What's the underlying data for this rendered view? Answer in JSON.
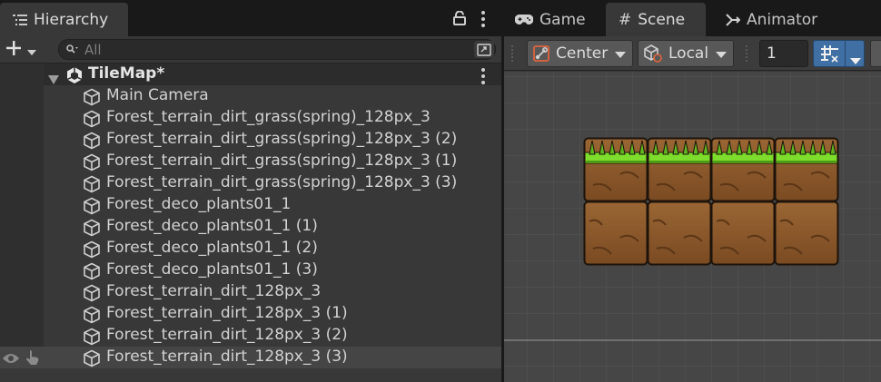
{
  "hierarchy": {
    "tab_label": "Hierarchy",
    "search_placeholder": "All",
    "scene_name": "TileMap*",
    "items": [
      {
        "label": "Main Camera"
      },
      {
        "label": "Forest_terrain_dirt_grass(spring)_128px_3"
      },
      {
        "label": "Forest_terrain_dirt_grass(spring)_128px_3 (2)"
      },
      {
        "label": "Forest_terrain_dirt_grass(spring)_128px_3 (1)"
      },
      {
        "label": "Forest_terrain_dirt_grass(spring)_128px_3 (3)"
      },
      {
        "label": "Forest_deco_plants01_1"
      },
      {
        "label": "Forest_deco_plants01_1 (1)"
      },
      {
        "label": "Forest_deco_plants01_1 (2)"
      },
      {
        "label": "Forest_deco_plants01_1 (3)"
      },
      {
        "label": "Forest_terrain_dirt_128px_3"
      },
      {
        "label": "Forest_terrain_dirt_128px_3 (1)"
      },
      {
        "label": "Forest_terrain_dirt_128px_3 (2)"
      },
      {
        "label": "Forest_terrain_dirt_128px_3 (3)"
      }
    ]
  },
  "tabs": {
    "game": "Game",
    "scene": "Scene",
    "animator": "Animator"
  },
  "scene_toolbar": {
    "pivot_mode": "Center",
    "pivot_rotation": "Local",
    "grid_size": "1"
  },
  "colors": {
    "selection_blue": "#3f6fa3",
    "grass": "#7bd32a",
    "dirt": "#8a5a2b"
  }
}
